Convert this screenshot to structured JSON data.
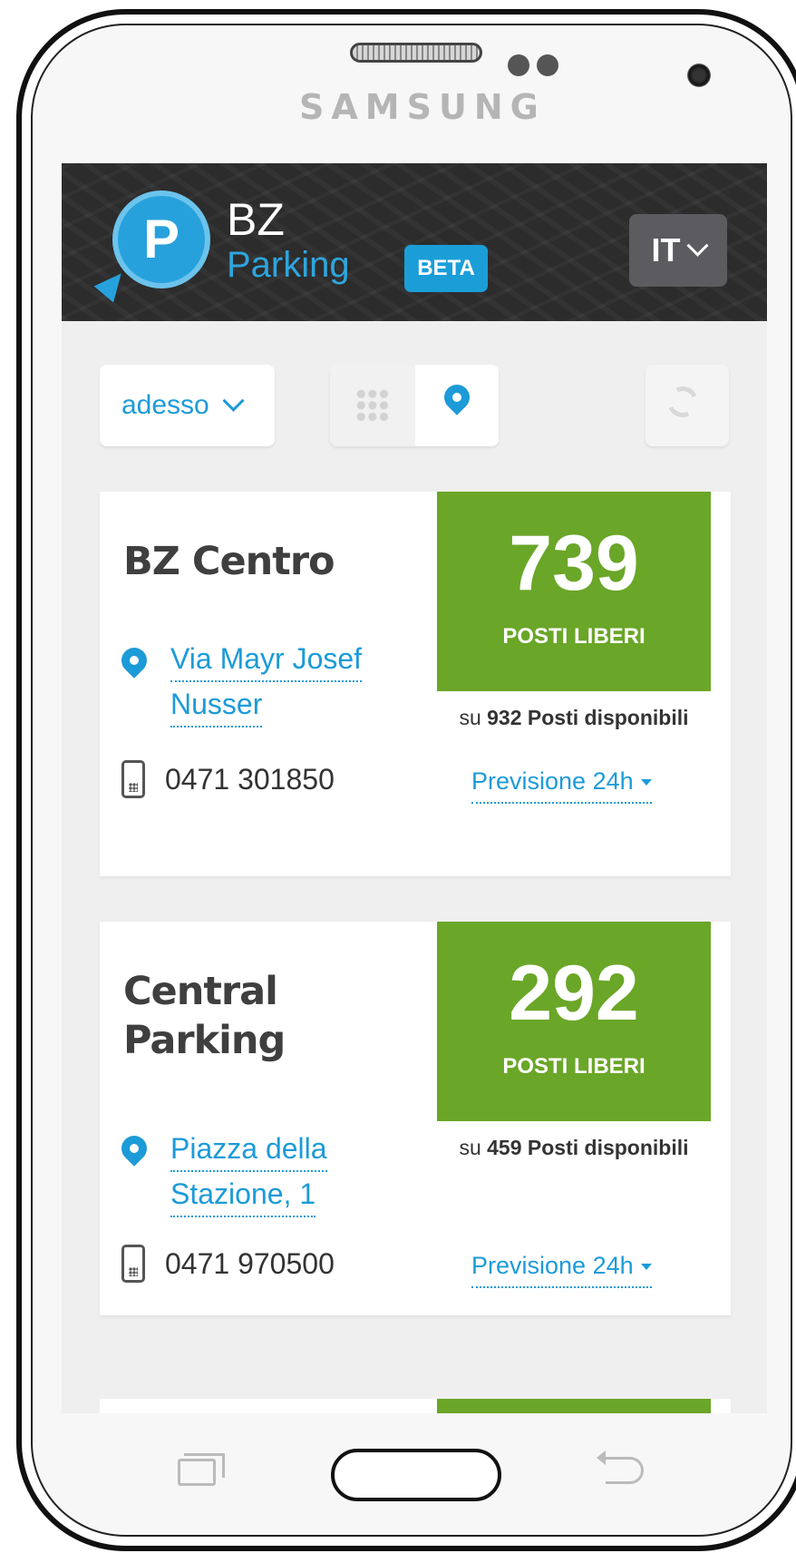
{
  "device": {
    "brand": "SAMSUNG"
  },
  "header": {
    "logo_letter": "P",
    "logo_line1": "BZ",
    "logo_line2": "Parking",
    "badge": "BETA",
    "language": "IT"
  },
  "controls": {
    "time_filter": "adesso"
  },
  "parkings": [
    {
      "name_lines": [
        "BZ Centro",
        ""
      ],
      "free": "739",
      "free_label": "POSTI LIBERI",
      "total_prefix": "su",
      "total": "932",
      "total_suffix": "Posti disponibili",
      "address_lines": [
        "Via Mayr Josef",
        "Nusser"
      ],
      "phone": "0471 301850",
      "forecast": "Previsione 24h"
    },
    {
      "name_lines": [
        "Central",
        "Parking"
      ],
      "free": "292",
      "free_label": "POSTI LIBERI",
      "total_prefix": "su",
      "total": "459",
      "total_suffix": "Posti disponibili",
      "address_lines": [
        "Piazza della",
        "Stazione, 1"
      ],
      "phone": "0471 970500",
      "forecast": "Previsione 24h"
    }
  ],
  "colors": {
    "accent": "#1c9bd8",
    "free_box": "#6aa628",
    "header_bg": "#2c2c2c"
  }
}
